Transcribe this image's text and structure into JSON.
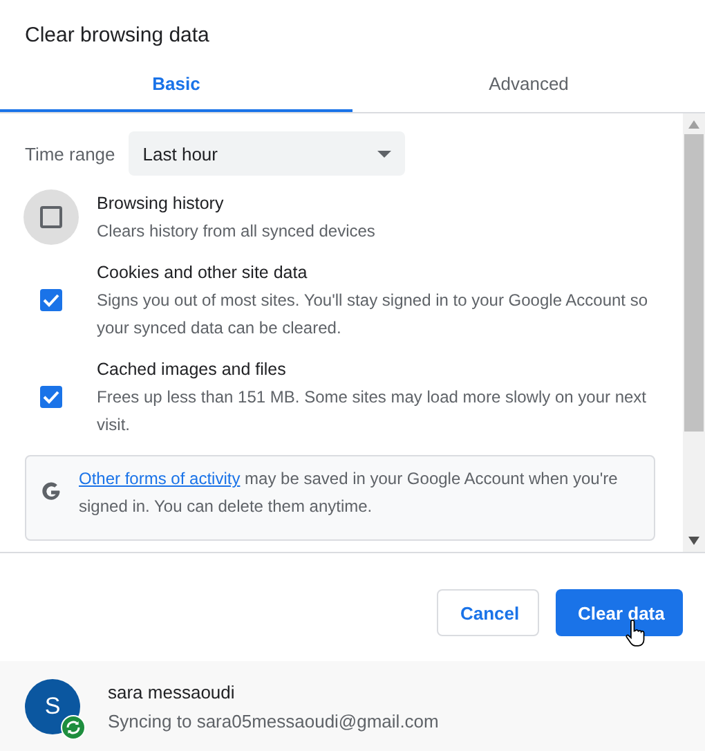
{
  "dialog": {
    "title": "Clear browsing data"
  },
  "tabs": [
    {
      "label": "Basic",
      "selected": true
    },
    {
      "label": "Advanced",
      "selected": false
    }
  ],
  "time_range": {
    "label": "Time range",
    "value": "Last hour"
  },
  "items": [
    {
      "title": "Browsing history",
      "description": "Clears history from all synced devices",
      "checked": false,
      "hovered": true
    },
    {
      "title": "Cookies and other site data",
      "description": "Signs you out of most sites. You'll stay signed in to your Google Account so your synced data can be cleared.",
      "checked": true,
      "hovered": false
    },
    {
      "title": "Cached images and files",
      "description": "Frees up less than 151 MB. Some sites may load more slowly on your next visit.",
      "checked": true,
      "hovered": false
    }
  ],
  "notice": {
    "link": "Other forms of activity",
    "text": " may be saved in your Google Account when you're signed in. You can delete them anytime."
  },
  "buttons": [
    {
      "label": "Cancel",
      "kind": "secondary"
    },
    {
      "label": "Clear data",
      "kind": "primary"
    }
  ],
  "account": {
    "initial": "S",
    "name": "sara messaoudi",
    "status": "Syncing to sara05messaoudi@gmail.com"
  }
}
